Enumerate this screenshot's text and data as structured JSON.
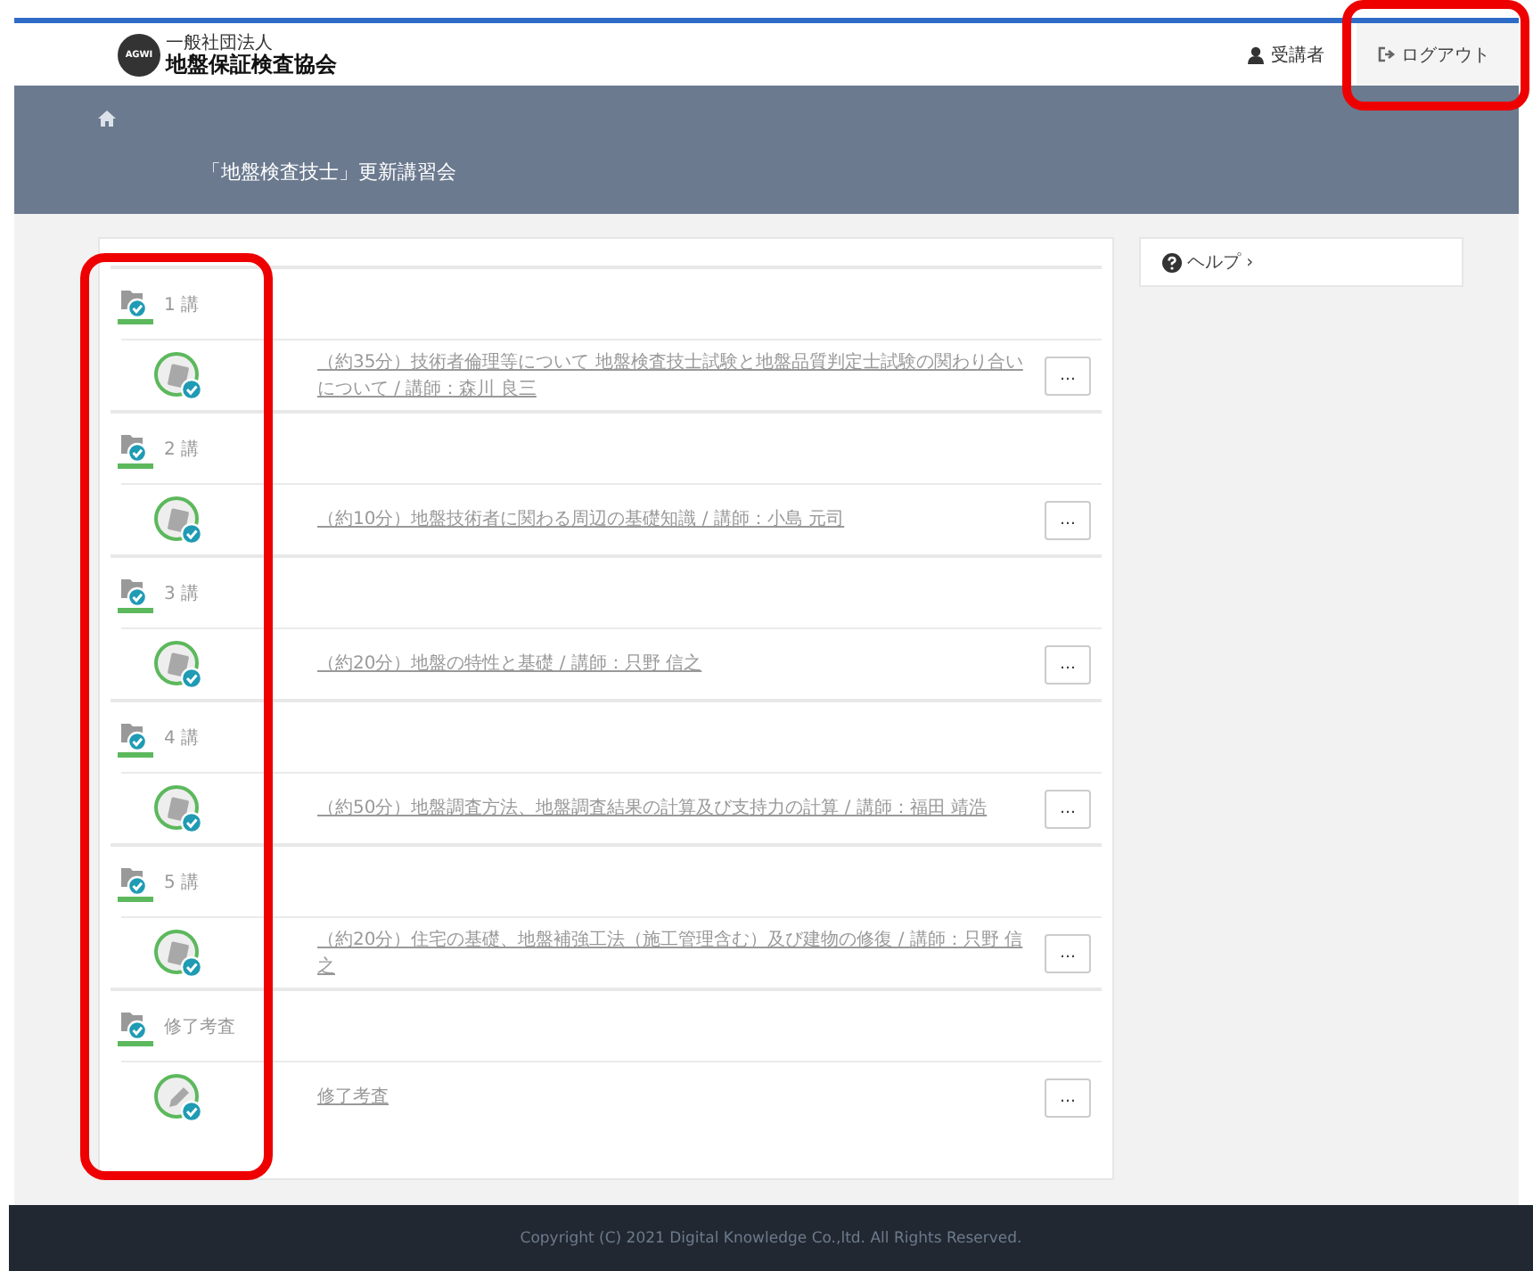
{
  "header": {
    "org_type": "一般社団法人",
    "org_name": "地盤保証検査協会",
    "logo_badge": "AGWI",
    "user": "受講者",
    "logout": {
      "label": "ログアウト",
      "highlighted": true
    }
  },
  "banner": {
    "title": "「地盤検査技士」更新講習会"
  },
  "course": {
    "highlighted": true,
    "chapters": [
      {
        "title": "1 講",
        "completed": true,
        "lessons": [
          {
            "kind": "lecture",
            "completed": true,
            "title": "（約35分）技術者倫理等について 地盤検査技士試験と地盤品質判定士試験の関わり合いについて / 講師：森川 良三",
            "more": "…"
          }
        ]
      },
      {
        "title": "2 講",
        "completed": true,
        "lessons": [
          {
            "kind": "lecture",
            "completed": true,
            "title": "（約10分）地盤技術者に関わる周辺の基礎知識 / 講師：小島 元司",
            "more": "…"
          }
        ]
      },
      {
        "title": "3 講",
        "completed": true,
        "lessons": [
          {
            "kind": "lecture",
            "completed": true,
            "title": "（約20分）地盤の特性と基礎 / 講師：只野 信之",
            "more": "…"
          }
        ]
      },
      {
        "title": "4 講",
        "completed": true,
        "lessons": [
          {
            "kind": "lecture",
            "completed": true,
            "title": "（約50分）地盤調査方法、地盤調査結果の計算及び支持力の計算 / 講師：福田 靖浩",
            "more": "…"
          }
        ]
      },
      {
        "title": "5 講",
        "completed": true,
        "lessons": [
          {
            "kind": "lecture",
            "completed": true,
            "title": "（約20分）住宅の基礎、地盤補強工法（施工管理含む）及び建物の修復 / 講師：只野 信之",
            "more": "…"
          }
        ]
      },
      {
        "title": "修了考査",
        "completed": true,
        "lessons": [
          {
            "kind": "exam",
            "completed": true,
            "title": "修了考査",
            "more": "…"
          }
        ]
      }
    ]
  },
  "help": {
    "label": "ヘルプ",
    "chevron": "›"
  },
  "footer": "Copyright (C) 2021 Digital Knowledge Co.,ltd. All Rights Reserved."
}
